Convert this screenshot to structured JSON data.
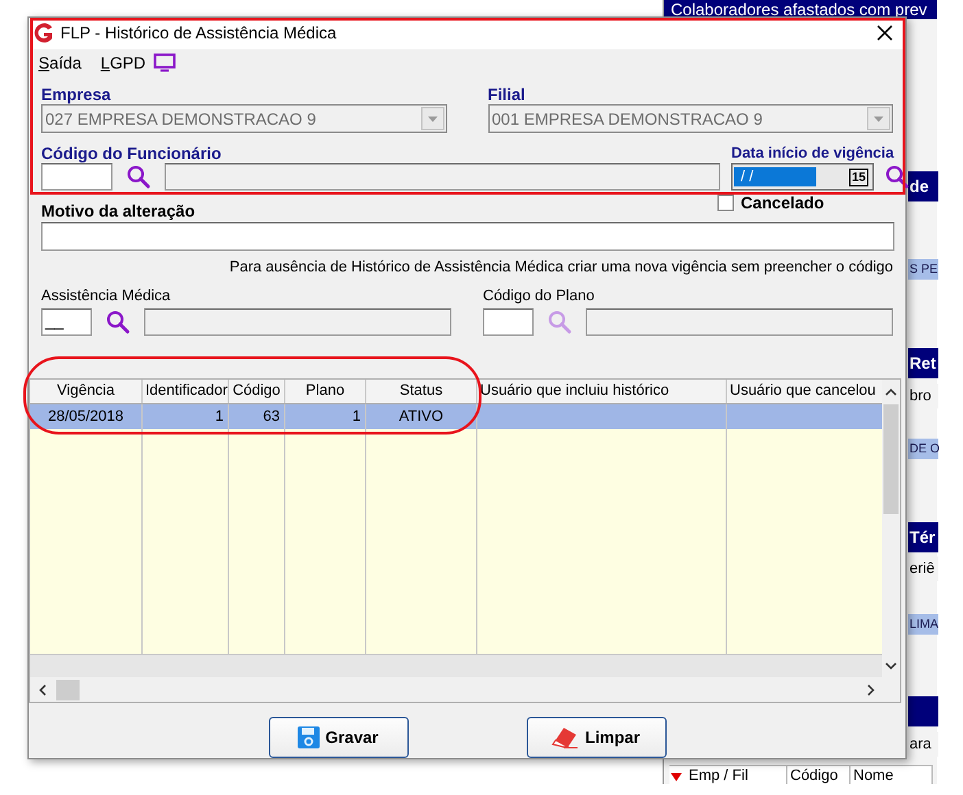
{
  "background_window": {
    "title": "Colaboradores afastados com prev",
    "fragments": [
      {
        "text": "de",
        "kind": "band"
      },
      {
        "text": "S PE",
        "kind": "highlight"
      },
      {
        "text": "Ret",
        "kind": "band"
      },
      {
        "text": "bro",
        "kind": "plain"
      },
      {
        "text": "DE O",
        "kind": "highlight"
      },
      {
        "text": "Tér",
        "kind": "band"
      },
      {
        "text": "eriê",
        "kind": "plain"
      },
      {
        "text": "LIMA",
        "kind": "highlight"
      },
      {
        "kind": "band"
      },
      {
        "text": "ara",
        "kind": "plain"
      }
    ],
    "columns": [
      "Emp / Fil",
      "Código",
      "Nome"
    ]
  },
  "window": {
    "title": "FLP - Histórico de Assistência Médica"
  },
  "menu": [
    {
      "label": "Saída"
    },
    {
      "label": "LGPD"
    }
  ],
  "form": {
    "empresa": {
      "label": "Empresa",
      "value": "027 EMPRESA DEMONSTRACAO 9"
    },
    "filial": {
      "label": "Filial",
      "value": "001 EMPRESA DEMONSTRACAO 9"
    },
    "codigo_funcionario": {
      "label": "Código do Funcionário"
    },
    "data_inicio": {
      "label": "Data início de vigência",
      "value": "/ /",
      "calendar": "15"
    },
    "cancelado": {
      "label": "Cancelado",
      "checked": false
    },
    "motivo": {
      "label": "Motivo da alteração"
    },
    "note": "Para ausência de Histórico de Assistência Médica criar uma nova vigência sem preencher o código",
    "assistencia": {
      "label": "Assistência Médica",
      "value": "__",
      "disabled": false
    },
    "codigo_plano": {
      "label": "Código do Plano",
      "disabled": true
    }
  },
  "table": {
    "columns": [
      "Vigência",
      "Identificador",
      "Código",
      "Plano",
      "Status",
      "Usuário que incluiu histórico",
      "Usuário que cancelou"
    ],
    "rows": [
      {
        "selected": true,
        "cells": [
          "28/05/2018",
          "1",
          "63",
          "1",
          "ATIVO",
          null,
          null
        ]
      }
    ]
  },
  "buttons": [
    {
      "label": "Gravar",
      "kind": "save"
    },
    {
      "label": "Limpar",
      "kind": "clear"
    }
  ]
}
